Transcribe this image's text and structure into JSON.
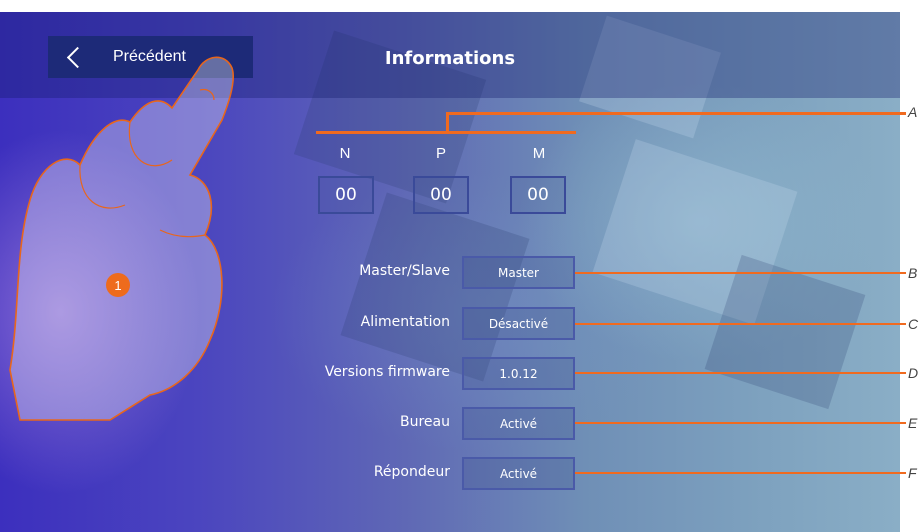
{
  "header": {
    "back_label": "Précédent",
    "title": "Informations"
  },
  "address": {
    "columns": [
      {
        "label": "N",
        "value": "00"
      },
      {
        "label": "P",
        "value": "00"
      },
      {
        "label": "M",
        "value": "00"
      }
    ]
  },
  "rows": [
    {
      "label": "Master/Slave",
      "value": "Master"
    },
    {
      "label": "Alimentation",
      "value": "Désactivé"
    },
    {
      "label": "Versions firmware",
      "value": "1.0.12"
    },
    {
      "label": "Bureau",
      "value": "Activé"
    },
    {
      "label": "Répondeur",
      "value": "Activé"
    }
  ],
  "callouts": {
    "A": "A",
    "B": "B",
    "C": "C",
    "D": "D",
    "E": "E",
    "F": "F"
  },
  "step_badge": "1",
  "colors": {
    "accent": "#f06a1f",
    "header_button": "#1d2a78"
  },
  "icons": {
    "back": "chevron-left-icon",
    "hand": "pointing-hand-icon"
  }
}
